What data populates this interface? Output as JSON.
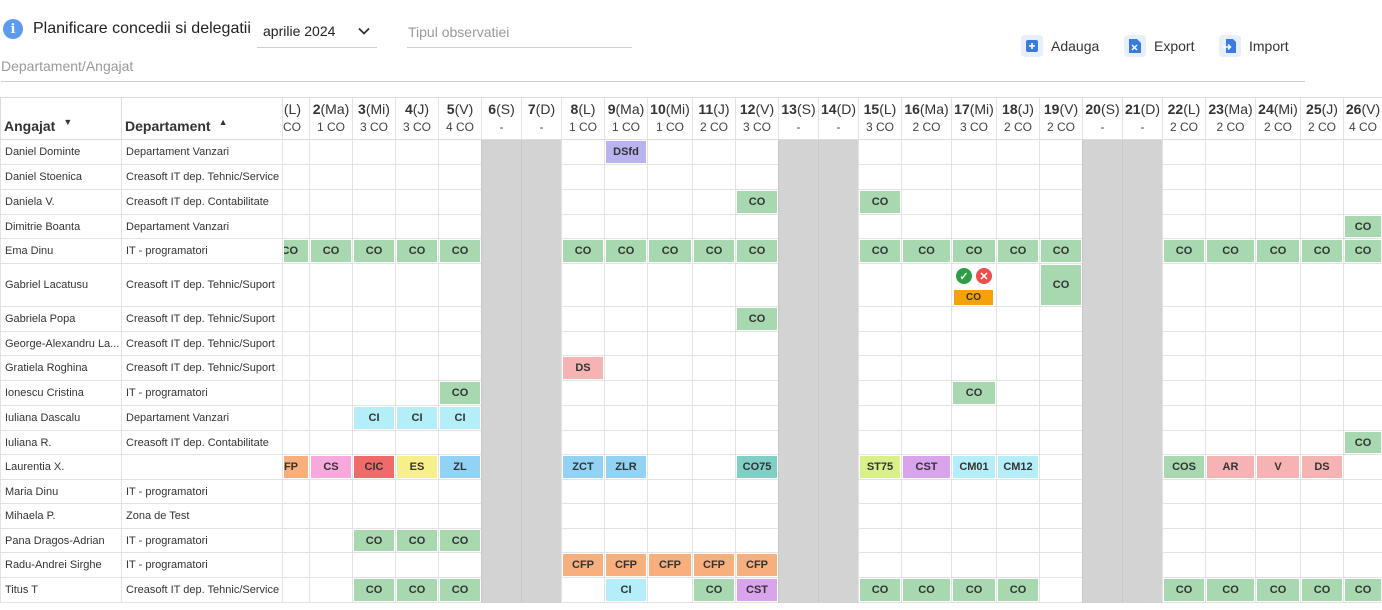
{
  "header": {
    "title": "Planificare concedii si delegatii",
    "month": "aprilie 2024",
    "observation_placeholder": "Tipul observatiei",
    "department_placeholder": "Departament/Angajat",
    "add_label": "Adauga",
    "export_label": "Export",
    "import_label": "Import"
  },
  "columns": {
    "employee": "Angajat",
    "department": "Departament"
  },
  "days": [
    {
      "num": "",
      "dow": "(L)",
      "count": "CO",
      "weekend": false
    },
    {
      "num": "2",
      "dow": "(Ma)",
      "count": "1 CO",
      "weekend": false
    },
    {
      "num": "3",
      "dow": "(Mi)",
      "count": "3 CO",
      "weekend": false
    },
    {
      "num": "4",
      "dow": "(J)",
      "count": "3 CO",
      "weekend": false
    },
    {
      "num": "5",
      "dow": "(V)",
      "count": "4 CO",
      "weekend": false
    },
    {
      "num": "6",
      "dow": "(S)",
      "count": "-",
      "weekend": true
    },
    {
      "num": "7",
      "dow": "(D)",
      "count": "-",
      "weekend": true
    },
    {
      "num": "8",
      "dow": "(L)",
      "count": "1 CO",
      "weekend": false
    },
    {
      "num": "9",
      "dow": "(Ma)",
      "count": "1 CO",
      "weekend": false
    },
    {
      "num": "10",
      "dow": "(Mi)",
      "count": "1 CO",
      "weekend": false
    },
    {
      "num": "11",
      "dow": "(J)",
      "count": "2 CO",
      "weekend": false
    },
    {
      "num": "12",
      "dow": "(V)",
      "count": "3 CO",
      "weekend": false
    },
    {
      "num": "13",
      "dow": "(S)",
      "count": "-",
      "weekend": true
    },
    {
      "num": "14",
      "dow": "(D)",
      "count": "-",
      "weekend": true
    },
    {
      "num": "15",
      "dow": "(L)",
      "count": "3 CO",
      "weekend": false
    },
    {
      "num": "16",
      "dow": "(Ma)",
      "count": "2 CO",
      "weekend": false
    },
    {
      "num": "17",
      "dow": "(Mi)",
      "count": "3 CO",
      "weekend": false
    },
    {
      "num": "18",
      "dow": "(J)",
      "count": "2 CO",
      "weekend": false
    },
    {
      "num": "19",
      "dow": "(V)",
      "count": "2 CO",
      "weekend": false
    },
    {
      "num": "20",
      "dow": "(S)",
      "count": "-",
      "weekend": true
    },
    {
      "num": "21",
      "dow": "(D)",
      "count": "-",
      "weekend": true
    },
    {
      "num": "22",
      "dow": "(L)",
      "count": "2 CO",
      "weekend": false
    },
    {
      "num": "23",
      "dow": "(Ma)",
      "count": "2 CO",
      "weekend": false
    },
    {
      "num": "24",
      "dow": "(Mi)",
      "count": "2 CO",
      "weekend": false
    },
    {
      "num": "25",
      "dow": "(J)",
      "count": "2 CO",
      "weekend": false
    },
    {
      "num": "26",
      "dow": "(V)",
      "count": "4 CO",
      "weekend": false
    }
  ],
  "legend_colors": {
    "CO": "#a8d8b0",
    "DSfd": "#b9b3f0",
    "CI": "#b4eef8",
    "DS": "#f5b3b3",
    "CFP": "#f7b07d",
    "CS": "#f7a8dc",
    "CIC": "#f06a6a",
    "ES": "#f7f08a",
    "ZL": "#92d2f5",
    "ZCT": "#92d2f5",
    "ZLR": "#92d2f5",
    "CO75": "#7fcfc6",
    "ST75": "#d8f08a",
    "CST": "#d9a4ec",
    "CM01": "#b4eef8",
    "CM12": "#b4eef8",
    "COS": "#a8d8b0",
    "AR": "#f5b3b3",
    "V": "#f5b3b3"
  },
  "rows": [
    {
      "name": "Daniel Dominte",
      "dept": "Departament Vanzari",
      "cells": [
        {
          "d": 8,
          "code": "DSfd"
        }
      ]
    },
    {
      "name": "Daniel Stoenica",
      "dept": "Creasoft IT dep. Tehnic/Service",
      "cells": []
    },
    {
      "name": "Daniela V.",
      "dept": "Creasoft IT dep. Contabilitate",
      "cells": [
        {
          "d": 11,
          "code": "CO"
        },
        {
          "d": 14,
          "code": "CO"
        }
      ]
    },
    {
      "name": "Dimitrie Boanta",
      "dept": "Departament Vanzari",
      "cells": [
        {
          "d": 25,
          "code": "CO"
        }
      ]
    },
    {
      "name": "Ema Dinu",
      "dept": "IT - programatori",
      "cells": [
        {
          "d": 0,
          "code": "CO"
        },
        {
          "d": 1,
          "code": "CO"
        },
        {
          "d": 2,
          "code": "CO"
        },
        {
          "d": 3,
          "code": "CO"
        },
        {
          "d": 4,
          "code": "CO"
        },
        {
          "d": 7,
          "code": "CO"
        },
        {
          "d": 8,
          "code": "CO"
        },
        {
          "d": 9,
          "code": "CO"
        },
        {
          "d": 10,
          "code": "CO"
        },
        {
          "d": 11,
          "code": "CO"
        },
        {
          "d": 14,
          "code": "CO"
        },
        {
          "d": 15,
          "code": "CO"
        },
        {
          "d": 16,
          "code": "CO"
        },
        {
          "d": 17,
          "code": "CO"
        },
        {
          "d": 18,
          "code": "CO"
        },
        {
          "d": 21,
          "code": "CO"
        },
        {
          "d": 22,
          "code": "CO"
        },
        {
          "d": 23,
          "code": "CO"
        },
        {
          "d": 24,
          "code": "CO"
        },
        {
          "d": 25,
          "code": "CO"
        }
      ]
    },
    {
      "name": "Gabriel Lacatusu",
      "dept": "Creasoft IT dep. Tehnic/Suport",
      "cells": [
        {
          "d": 16,
          "code": "CO",
          "pending": true
        },
        {
          "d": 18,
          "code": "CO"
        }
      ]
    },
    {
      "name": "Gabriela Popa",
      "dept": "Creasoft IT dep. Tehnic/Suport",
      "cells": [
        {
          "d": 11,
          "code": "CO"
        }
      ]
    },
    {
      "name": "George-Alexandru La...",
      "dept": "Creasoft IT dep. Tehnic/Suport",
      "cells": []
    },
    {
      "name": "Gratiela Roghina",
      "dept": "Creasoft IT dep. Tehnic/Suport",
      "cells": [
        {
          "d": 7,
          "code": "DS"
        }
      ]
    },
    {
      "name": "Ionescu Cristina",
      "dept": "IT - programatori",
      "cells": [
        {
          "d": 4,
          "code": "CO"
        },
        {
          "d": 16,
          "code": "CO"
        }
      ]
    },
    {
      "name": "Iuliana Dascalu",
      "dept": "Departament Vanzari",
      "cells": [
        {
          "d": 2,
          "code": "CI"
        },
        {
          "d": 3,
          "code": "CI"
        },
        {
          "d": 4,
          "code": "CI"
        }
      ]
    },
    {
      "name": "Iuliana R.",
      "dept": "Creasoft IT dep. Contabilitate",
      "cells": [
        {
          "d": 25,
          "code": "CO"
        }
      ]
    },
    {
      "name": "Laurentia X.",
      "dept": "",
      "cells": [
        {
          "d": 0,
          "code": "CFP"
        },
        {
          "d": 1,
          "code": "CS"
        },
        {
          "d": 2,
          "code": "CIC"
        },
        {
          "d": 3,
          "code": "ES"
        },
        {
          "d": 4,
          "code": "ZL"
        },
        {
          "d": 7,
          "code": "ZCT"
        },
        {
          "d": 8,
          "code": "ZLR"
        },
        {
          "d": 11,
          "code": "CO75"
        },
        {
          "d": 14,
          "code": "ST75"
        },
        {
          "d": 15,
          "code": "CST"
        },
        {
          "d": 16,
          "code": "CM01"
        },
        {
          "d": 17,
          "code": "CM12"
        },
        {
          "d": 21,
          "code": "COS"
        },
        {
          "d": 22,
          "code": "AR"
        },
        {
          "d": 23,
          "code": "V"
        },
        {
          "d": 24,
          "code": "DS"
        }
      ]
    },
    {
      "name": "Maria Dinu",
      "dept": "IT - programatori",
      "cells": []
    },
    {
      "name": "Mihaela P.",
      "dept": "Zona de Test",
      "cells": []
    },
    {
      "name": "Pana Dragos-Adrian",
      "dept": "IT - programatori",
      "cells": [
        {
          "d": 2,
          "code": "CO"
        },
        {
          "d": 3,
          "code": "CO"
        },
        {
          "d": 4,
          "code": "CO"
        }
      ]
    },
    {
      "name": "Radu-Andrei Sirghe",
      "dept": "IT - programatori",
      "cells": [
        {
          "d": 7,
          "code": "CFP"
        },
        {
          "d": 8,
          "code": "CFP"
        },
        {
          "d": 9,
          "code": "CFP"
        },
        {
          "d": 10,
          "code": "CFP"
        },
        {
          "d": 11,
          "code": "CFP"
        }
      ]
    },
    {
      "name": "Titus T",
      "dept": "Creasoft IT dep. Tehnic/Service",
      "cells": [
        {
          "d": 2,
          "code": "CO"
        },
        {
          "d": 3,
          "code": "CO"
        },
        {
          "d": 4,
          "code": "CO"
        },
        {
          "d": 8,
          "code": "CI"
        },
        {
          "d": 10,
          "code": "CO"
        },
        {
          "d": 11,
          "code": "CST"
        },
        {
          "d": 14,
          "code": "CO"
        },
        {
          "d": 15,
          "code": "CO"
        },
        {
          "d": 16,
          "code": "CO"
        },
        {
          "d": 17,
          "code": "CO"
        },
        {
          "d": 21,
          "code": "CO"
        },
        {
          "d": 22,
          "code": "CO"
        },
        {
          "d": 23,
          "code": "CO"
        },
        {
          "d": 24,
          "code": "CO"
        },
        {
          "d": 25,
          "code": "CO"
        }
      ]
    }
  ]
}
